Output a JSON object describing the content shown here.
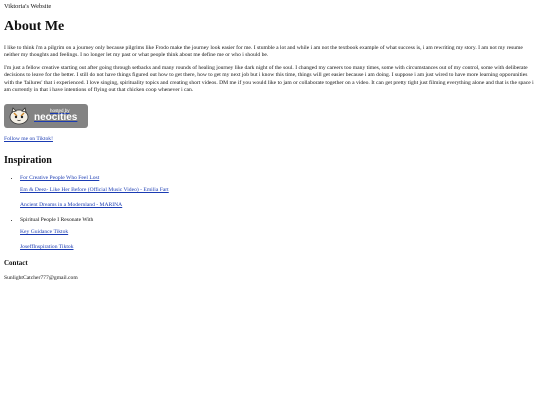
{
  "site_title": "Viktoria's Website",
  "about": {
    "heading": "About Me",
    "para1": "I like to think i'm a pilgrim on a journey only because pilgrims like Frodo make the journey look easier for me. I stumble a lot and while i am not the textbook example of what success is, i am rewriting my story. I am not my resume neither my thoughts and feelings. I no longer let my past or what people think about me define me or who i should be.",
    "para2": "I'm just a fellow creative starting out after going through setbacks and many rounds of healing journey like dark night of the soul. I changed my careers too many times, some with circumstances out of my control, some with deliberate decisions to leave for the better. I still do not have things figured out how to get there, how to get my next job but i know this time, things will get easier because i am doing. I suppose i am just wired to have more learning opporunities with the 'failures' that i experienced. I love singing, spirituality topics and creating short videos. DM me if you would like to jam or collaborate together on a video. It can get pretty tight just filming everything alone and that is the space i am currently in that i have intentions of flying out that chicken coop whenever i can."
  },
  "badge": {
    "small_text": "hosted by",
    "big_text": "neocities"
  },
  "tiktok_link": "Follow me on Tiktok!",
  "inspiration": {
    "heading": "Inspiration",
    "item1": "For Creative People Who Feel Lost",
    "item1_links": [
      "Em & Deez- Like Her Before (Official Music Video) - Emilia Fart",
      "Ancient Dreams in a Modernland - MARINA"
    ],
    "item2": "Spiritual People I Resonate With",
    "item2_links": [
      "Key Guidance Tiktok",
      "JoseffInspiration Tiktok"
    ]
  },
  "contact": {
    "heading": "Contact",
    "email": "SunlightCatcher777@gmail.com"
  },
  "colors": {
    "link": "#1a3bb3",
    "badge_bg": "#838383"
  }
}
